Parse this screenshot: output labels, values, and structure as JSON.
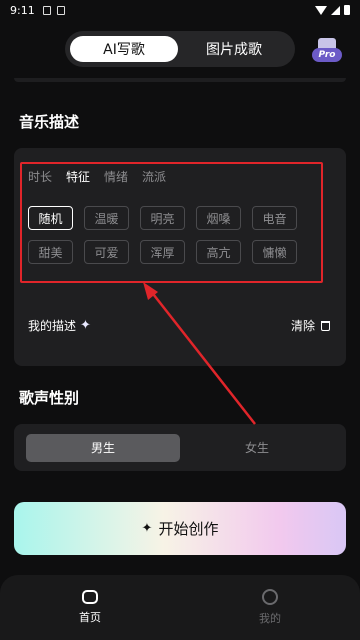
{
  "status_bar": {
    "time": "9:11"
  },
  "top_tabs": {
    "ai_write": "AI写歌",
    "image_song": "图片成歌"
  },
  "pro_badge": "Pro",
  "music_section": {
    "title": "音乐描述",
    "subtabs": [
      "时长",
      "特征",
      "情绪",
      "流派"
    ],
    "active_subtab": "特征",
    "chips": [
      "随机",
      "温暖",
      "明亮",
      "烟嗓",
      "电音",
      "甜美",
      "可爱",
      "浑厚",
      "高亢",
      "慵懒"
    ],
    "selected_chip": "随机",
    "my_description": "我的描述",
    "clear": "清除"
  },
  "voice_section": {
    "title": "歌声性别",
    "male": "男生",
    "female": "女生",
    "selected": "男生"
  },
  "cta": {
    "label": "开始创作"
  },
  "bottom_nav": {
    "home": "首页",
    "mine": "我的"
  },
  "colors": {
    "highlight_box": "#e0252a",
    "background": "#0e0e0f",
    "card": "#1f1f21"
  }
}
